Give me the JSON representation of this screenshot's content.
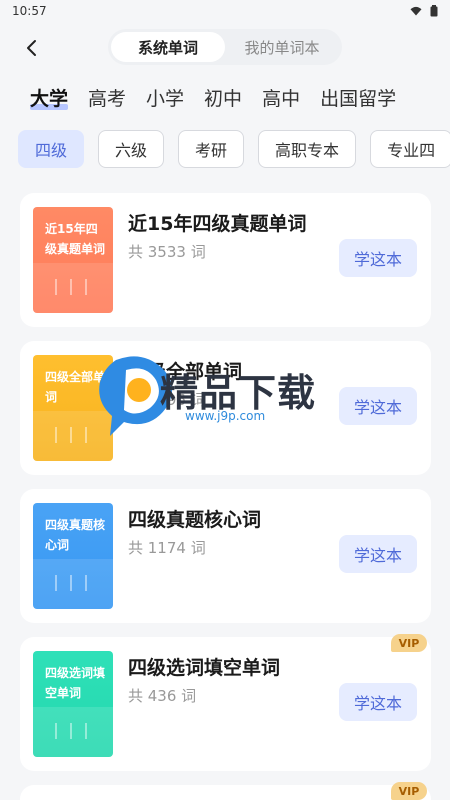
{
  "status": {
    "time": "10:57"
  },
  "header": {
    "tabs": [
      {
        "label": "系统单词"
      },
      {
        "label": "我的单词本"
      }
    ]
  },
  "levels": [
    "大学",
    "高考",
    "小学",
    "初中",
    "高中",
    "出国留学"
  ],
  "chips": [
    "四级",
    "六级",
    "考研",
    "高职专本",
    "专业四"
  ],
  "books": [
    {
      "cover_text": "近15年四级真题单词",
      "title": "近15年四级真题单词",
      "count": "共 3533 词",
      "button": "学这本",
      "cover_color": "#ff8a65",
      "cover_color2": "#ff7a57",
      "vip": ""
    },
    {
      "cover_text": "四级全部单词",
      "title": "四级全部单词",
      "count": "共 4096 词",
      "button": "学这本",
      "cover_color": "#ffbf2f",
      "cover_color2": "#f7b21d",
      "vip": ""
    },
    {
      "cover_text": "四级真题核心词",
      "title": "四级真题核心词",
      "count": "共 1174 词",
      "button": "学这本",
      "cover_color": "#4aa3f5",
      "cover_color2": "#3597f3",
      "vip": ""
    },
    {
      "cover_text": "四级选词填空单词",
      "title": "四级选词填空单词",
      "count": "共 436 词",
      "button": "学这本",
      "cover_color": "#2fe0b8",
      "cover_color2": "#23d8ae",
      "vip": "VIP"
    },
    {
      "cover_text": "",
      "title": "",
      "count": "",
      "button": "",
      "cover_color": "#ffffff",
      "cover_color2": "#ffffff",
      "vip": "VIP"
    }
  ],
  "watermark": {
    "title": "精品下载",
    "url": "www.j9p.com"
  }
}
